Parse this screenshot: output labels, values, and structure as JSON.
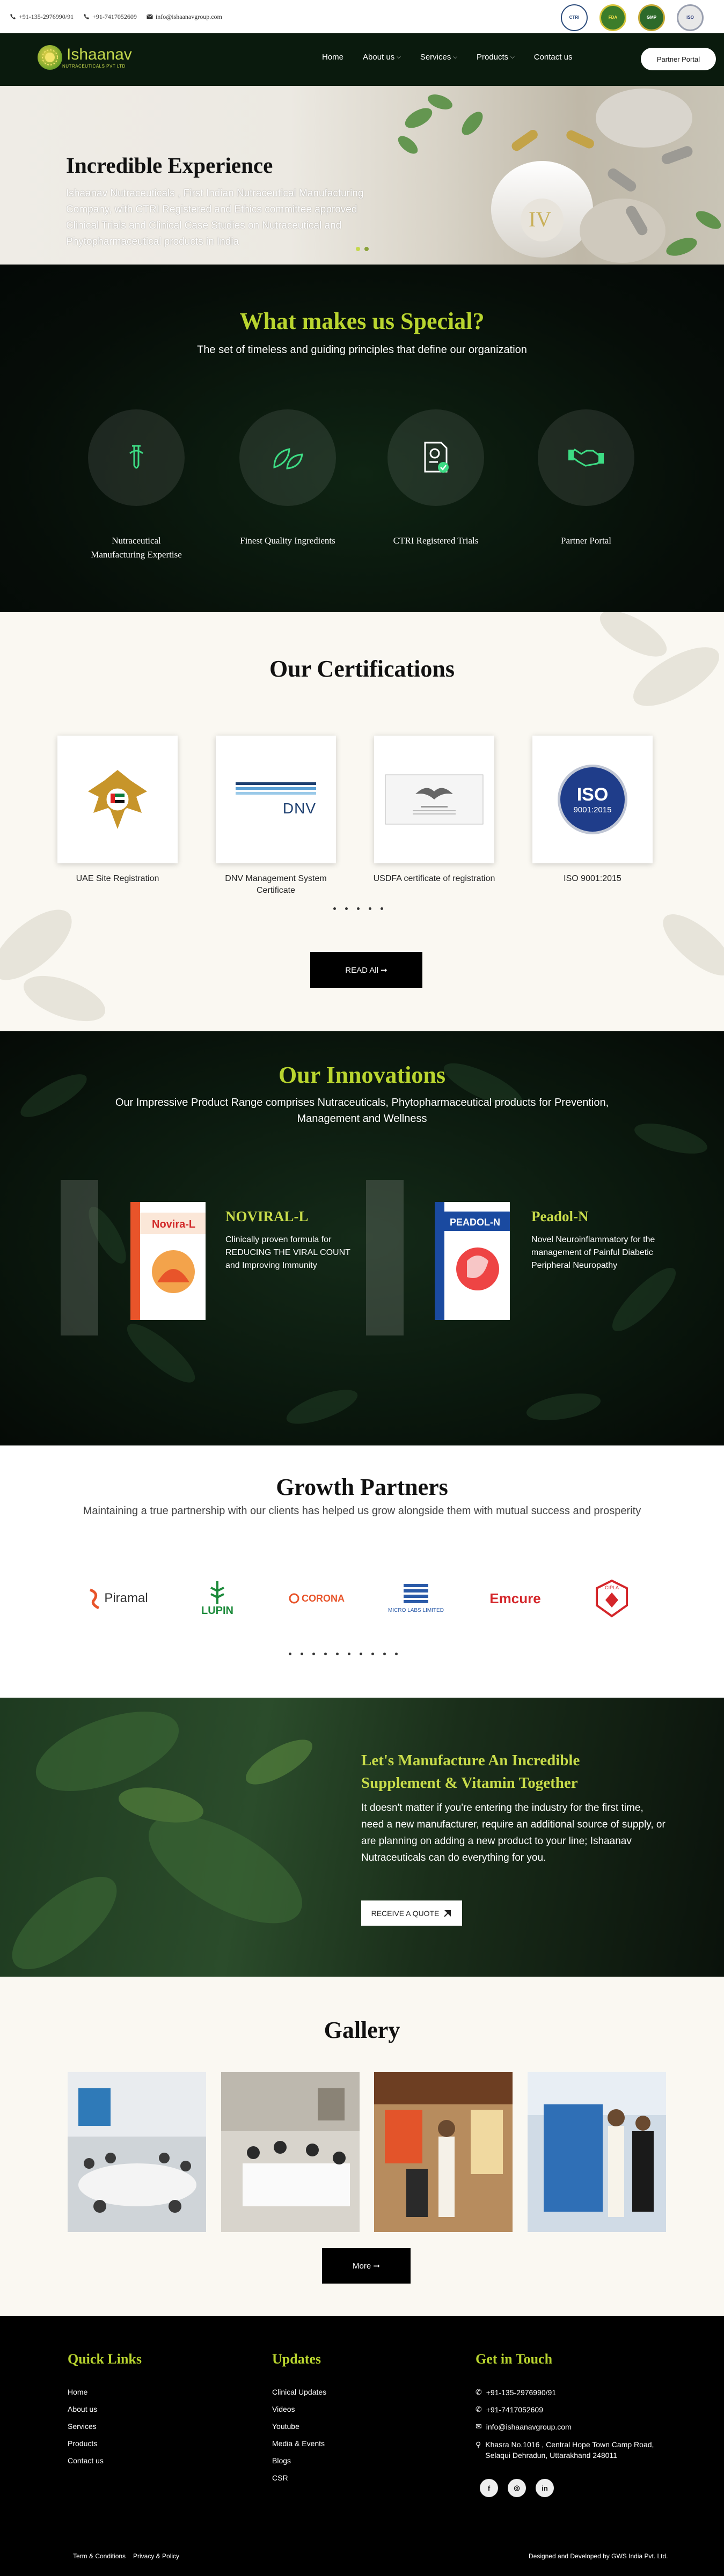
{
  "topbar": {
    "phone1": "+91-135-2976990/91",
    "phone2": "+91-7417052609",
    "email": "info@ishaanavgroup.com",
    "badges": [
      "CTRI",
      "FDA",
      "GMP",
      "ISO"
    ]
  },
  "nav": {
    "logo_text": "Ishaanav",
    "logo_sub": "NUTRACEUTICALS PVT LTD",
    "items": [
      "Home",
      "About us",
      "Services",
      "Products",
      "Contact us"
    ],
    "portal_button": "Partner Portal"
  },
  "hero": {
    "title": "Incredible Experience",
    "body": "Ishaanav Nutraceuticals , First Indian Nutraceutical Manufacturing Company, with CTRI Registered and Ethics committee approved Clinical Trials and Clinical Case Studies on Nutraceutical and Phytopharmaceutical products in India"
  },
  "special": {
    "title": "What makes us Special?",
    "subtitle": "The set of timeless and guiding principles that define our organization",
    "features": [
      {
        "label": "Nutraceutical Manufacturing Expertise",
        "icon": "test-tube-icon"
      },
      {
        "label": "Finest Quality Ingredients",
        "icon": "leaves-icon"
      },
      {
        "label": "CTRI Registered Trials",
        "icon": "certificate-icon"
      },
      {
        "label": "Partner Portal",
        "icon": "handshake-icon"
      }
    ]
  },
  "certifications": {
    "title": "Our Certifications",
    "items": [
      {
        "label": "UAE Site Registration"
      },
      {
        "label": "DNV Management System Certificate",
        "card_text": "DNV"
      },
      {
        "label": "USDFA certificate of registration"
      },
      {
        "label": "ISO 9001:2015",
        "card_text": "ISO",
        "card_subtext": "9001:2015"
      }
    ],
    "button": "READ All ➞"
  },
  "innovations": {
    "title": "Our Innovations",
    "subtitle": "Our Impressive Product Range comprises Nutraceuticals, Phytopharmaceutical products for Prevention, Management and Wellness",
    "products": [
      {
        "name": "NOVIRAL-L",
        "desc": "Clinically proven formula for REDUCING THE VIRAL COUNT and Improving Immunity",
        "box_label": "Novira-L"
      },
      {
        "name": "Peadol-N",
        "desc": "Novel Neuroinflammatory for the management of Painful Diabetic Peripheral Neuropathy",
        "box_label": "PEADOL-N"
      }
    ]
  },
  "partners": {
    "title": "Growth Partners",
    "subtitle": "Maintaining a true partnership with our clients has helped us grow alongside them with mutual success and prosperity",
    "logos": [
      "Piramal",
      "LUPIN",
      "CORONA",
      "MICRO LABS LIMITED",
      "Emcure",
      "CIPLA"
    ]
  },
  "manufacture": {
    "title": "Let's Manufacture An Incredible Supplement & Vitamin Together",
    "body": "It doesn't matter if you're entering the industry for the first time, need a new manufacturer, require an additional source of supply, or are planning on adding a new product to your line; Ishaanav Nutraceuticals can do everything for you.",
    "button": "RECEIVE A QUOTE"
  },
  "gallery": {
    "title": "Gallery",
    "button": "More ➞"
  },
  "footer": {
    "quick_links_title": "Quick Links",
    "quick_links": [
      "Home",
      "About us",
      "Services",
      "Products",
      "Contact us"
    ],
    "updates_title": "Updates",
    "updates": [
      "Clinical Updates",
      "Videos",
      "Youtube",
      "Media & Events",
      "Blogs",
      "CSR"
    ],
    "contact_title": "Get in Touch",
    "phone1": "+91-135-2976990/91",
    "phone2": "+91-7417052609",
    "email": "info@ishaanavgroup.com",
    "address": "Khasra No.1016 , Central Hope Town Camp Road, Selaqui Dehradun, Uttarakhand 248011",
    "social": [
      "f",
      "◎",
      "in"
    ],
    "terms": "Term & Conditions",
    "privacy": "Privacy & Policy",
    "credit": "Designed and Developed by GWS India Pvt. Ltd."
  }
}
